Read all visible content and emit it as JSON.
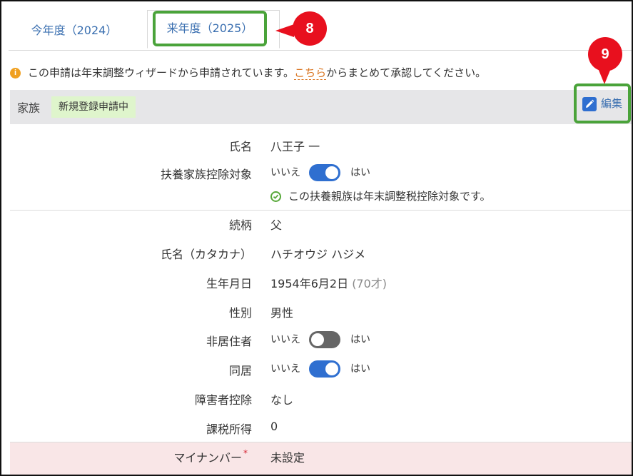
{
  "tabs": [
    {
      "label": "今年度（2024）",
      "active": false
    },
    {
      "label": "来年度（2025）",
      "active": true
    }
  ],
  "callouts": {
    "first": "8",
    "second": "9"
  },
  "notice": {
    "prefix": "この申請は年末調整ウィザードから申請されています。",
    "link": "こちら",
    "suffix": "からまとめて承認してください。",
    "icon": "info-icon"
  },
  "section": {
    "title": "家族",
    "badge": "新規登録申請中",
    "edit_label": "編集"
  },
  "fields": {
    "name": {
      "label": "氏名",
      "value": "八王子 一"
    },
    "dependent_deduction": {
      "label": "扶養家族控除対象",
      "off_text": "いいえ",
      "on_text": "はい",
      "state": "on"
    },
    "deduction_note": "この扶養親族は年末調整税控除対象です。",
    "relationship": {
      "label": "続柄",
      "value": "父"
    },
    "name_kana": {
      "label": "氏名（カタカナ）",
      "value": "ハチオウジ ハジメ"
    },
    "birthday": {
      "label": "生年月日",
      "value": "1954年6月2日",
      "age": "(70才)"
    },
    "gender": {
      "label": "性別",
      "value": "男性"
    },
    "non_resident": {
      "label": "非居住者",
      "off_text": "いいえ",
      "on_text": "はい",
      "state": "off"
    },
    "cohabiting": {
      "label": "同居",
      "off_text": "いいえ",
      "on_text": "はい",
      "state": "on"
    },
    "disability": {
      "label": "障害者控除",
      "value": "なし"
    },
    "taxable_income": {
      "label": "課税所得",
      "value": "0"
    },
    "my_number": {
      "label": "マイナンバー",
      "required_mark": "*",
      "value": "未設定"
    }
  },
  "colors": {
    "accent": "#2f6fd0",
    "highlight": "#4aa33a",
    "callout": "#e8101e",
    "link": "#d9731e"
  }
}
